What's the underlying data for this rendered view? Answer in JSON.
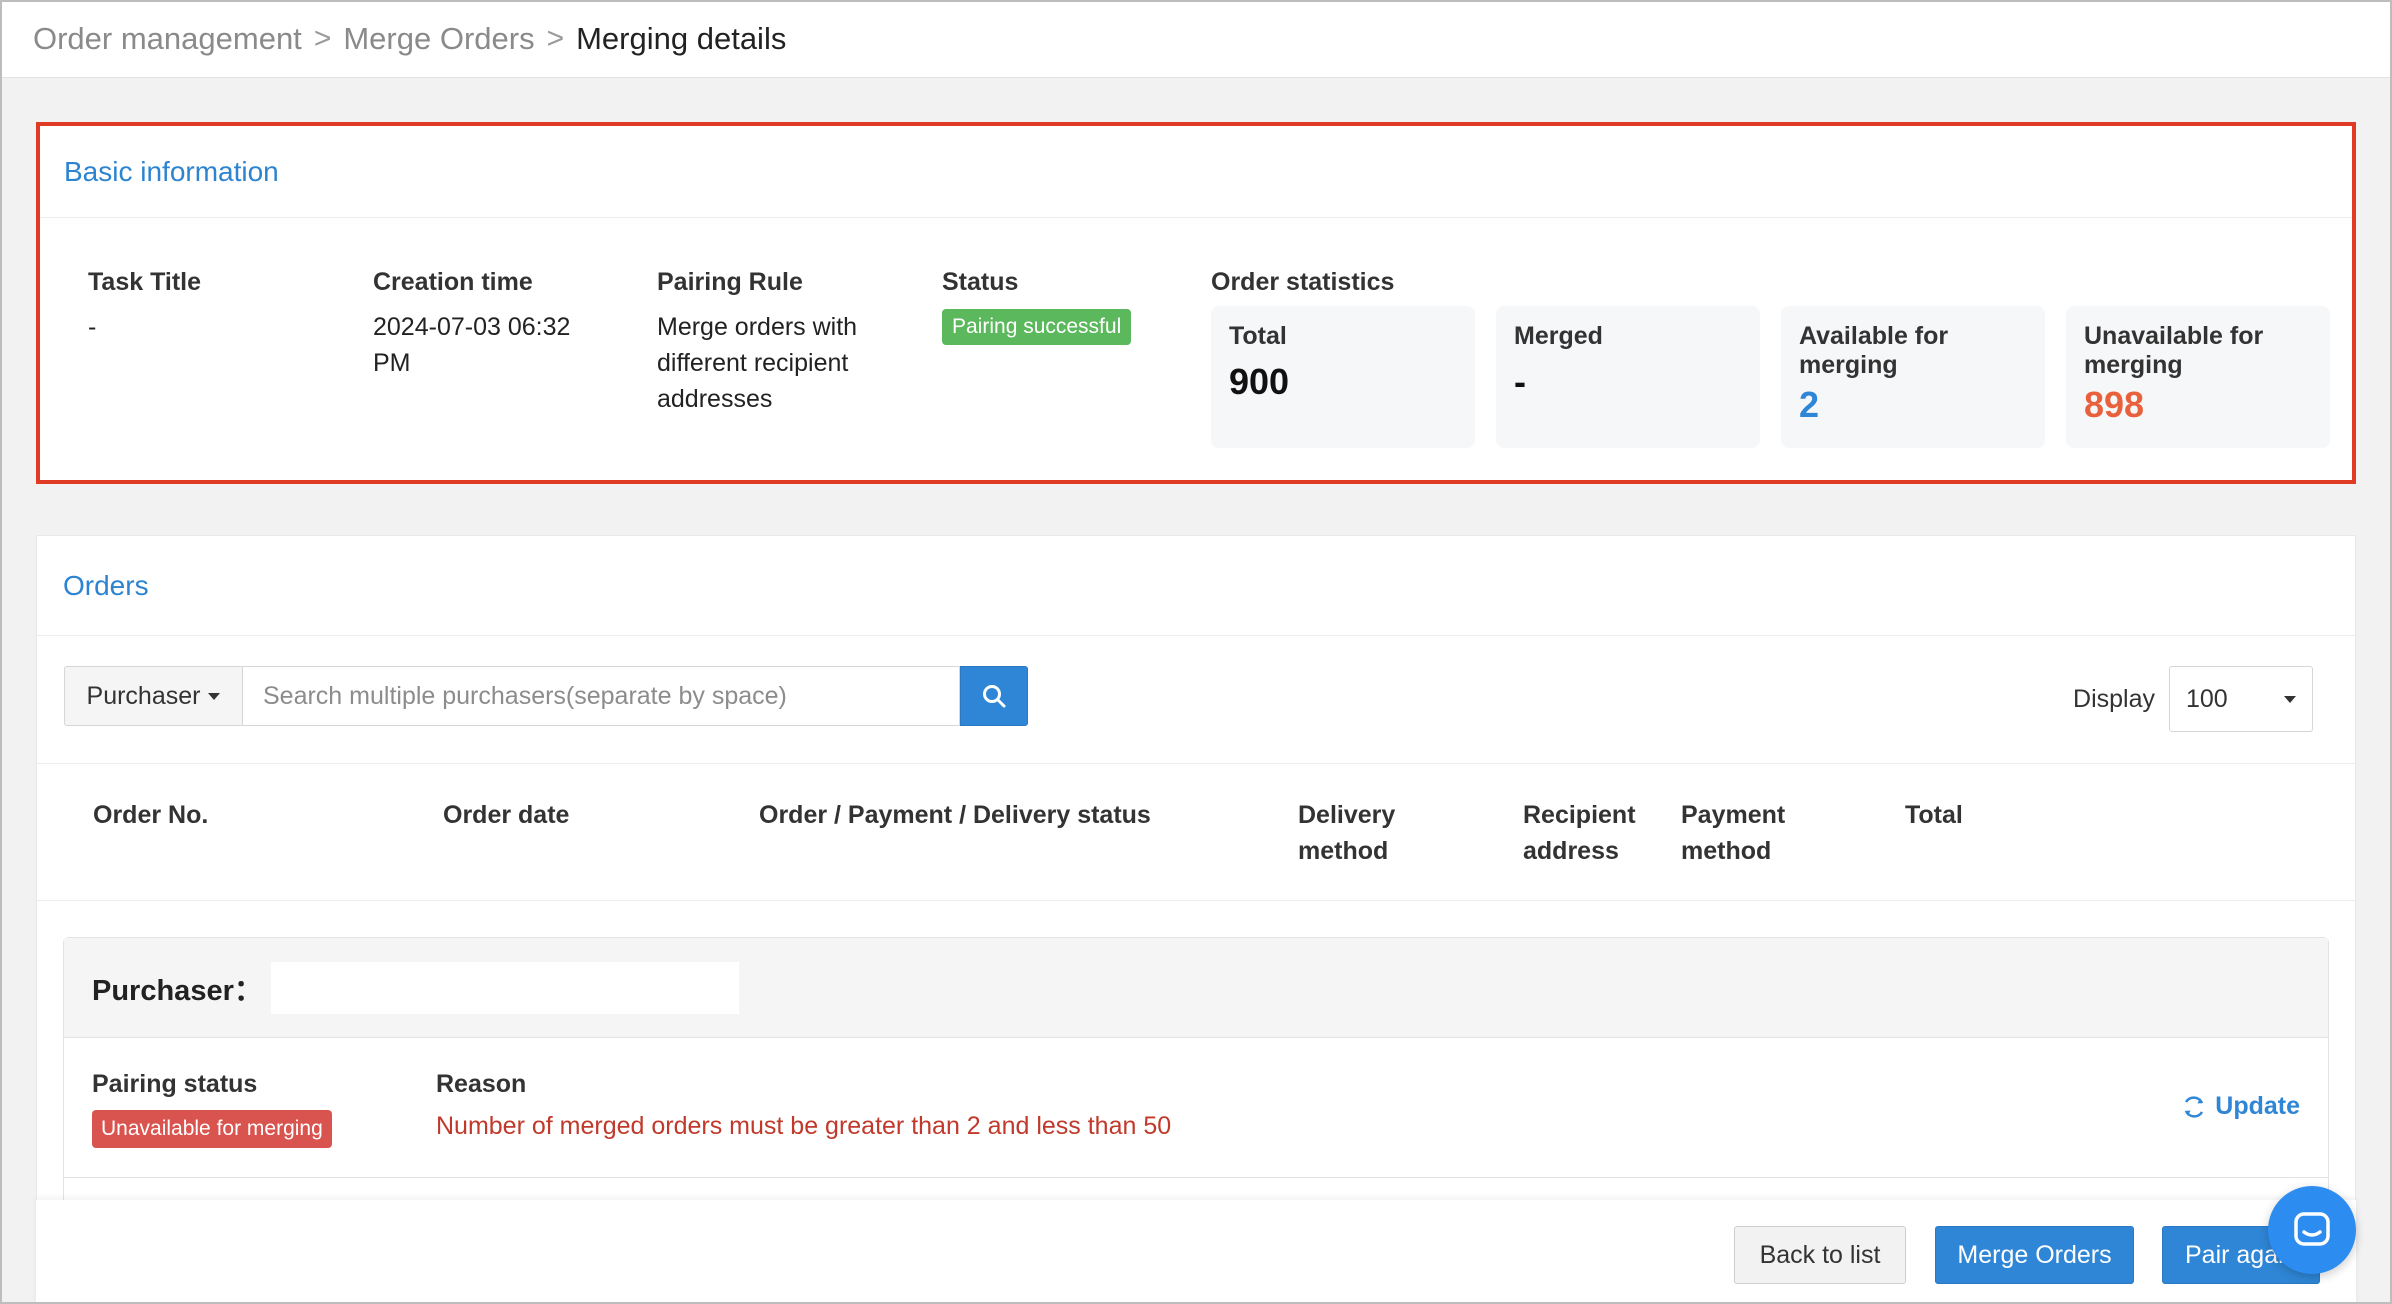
{
  "breadcrumb": {
    "items": [
      "Order management",
      "Merge Orders",
      "Merging details"
    ],
    "separator": ">"
  },
  "basic_info": {
    "title": "Basic information",
    "task_title_label": "Task Title",
    "task_title_value": "-",
    "creation_time_label": "Creation time",
    "creation_time_value": "2024-07-03 06:32 PM",
    "pairing_rule_label": "Pairing Rule",
    "pairing_rule_value": "Merge orders with different recipient addresses",
    "status_label": "Status",
    "status_value": "Pairing successful",
    "stats_label": "Order statistics",
    "stats": [
      {
        "label": "Total",
        "value": "900",
        "color": "#111111"
      },
      {
        "label": "Merged",
        "value": "-",
        "color": "#111111"
      },
      {
        "label": "Available for merging",
        "value": "2",
        "color": "#2f86d6"
      },
      {
        "label": "Unavailable for merging",
        "value": "898",
        "color": "#e8603c"
      }
    ]
  },
  "orders": {
    "title": "Orders",
    "filter_label": "Purchaser",
    "search_placeholder": "Search multiple purchasers(separate by space)",
    "display_label": "Display",
    "display_value": "100",
    "columns": [
      "Order No.",
      "Order date",
      "Order / Payment / Delivery status",
      "Delivery method",
      "Recipient address",
      "Payment method",
      "Total"
    ],
    "group": {
      "purchaser_label": "Purchaser：",
      "pairing_status_label": "Pairing status",
      "pairing_status_value": "Unavailable for merging",
      "reason_label": "Reason",
      "reason_value": "Number of merged orders must be greater than 2 and less than 50",
      "update_label": "Update"
    }
  },
  "footer": {
    "back_label": "Back to list",
    "merge_label": "Merge Orders",
    "pair_label": "Pair agai"
  },
  "colors": {
    "accent": "#2f86d6",
    "highlight_border": "#e03b24",
    "success": "#5cb85c",
    "danger": "#d9534f"
  }
}
